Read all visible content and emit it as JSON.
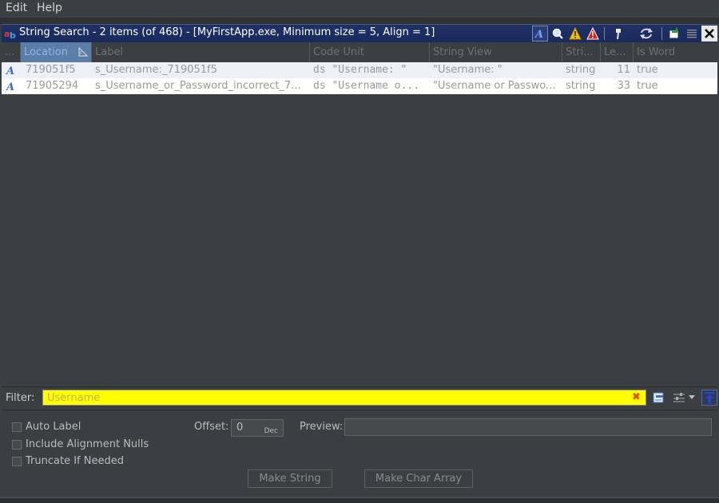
{
  "menu": {
    "edit": "Edit",
    "help": "Help"
  },
  "window": {
    "title": "String Search - 2 items (of 468) - [MyFirstApp.exe, Minimum size = 5, Align = 1]"
  },
  "table": {
    "columns": {
      "icon": "...",
      "location": "Location",
      "label": "Label",
      "code_unit": "Code Unit",
      "string_view": "String View",
      "string_type": "Stri...",
      "length": "Le...",
      "is_word": "Is Word"
    },
    "rows": [
      {
        "location": "719051f5",
        "label": "s_Username:_719051f5",
        "code_unit": "ds \"Username: \"",
        "string_view": "\"Username: \"",
        "string_type": "string",
        "length": "11",
        "is_word": "true"
      },
      {
        "location": "71905294",
        "label": "s_Username_or_Password_incorrect_7...",
        "code_unit": "ds \"Username o...",
        "string_view": "\"Username or Passwo...",
        "string_type": "string",
        "length": "33",
        "is_word": "true"
      }
    ]
  },
  "filter": {
    "label": "Filter:",
    "placeholder": "Username"
  },
  "options": {
    "auto_label": "Auto Label",
    "include_alignment_nulls": "Include Alignment Nulls",
    "truncate_if_needed": "Truncate If Needed",
    "offset_label": "Offset:",
    "offset_value": "0",
    "offset_unit": "Dec",
    "preview_label": "Preview:",
    "make_string": "Make String",
    "make_char_array": "Make Char Array"
  },
  "colors": {
    "accent": "#1f3168",
    "filter_bg": "#ffff00",
    "selected_header": "#5a7ea8"
  },
  "icons": [
    "string-search-icon",
    "defined-strings-filter-icon",
    "search-icon",
    "warning-icon",
    "error-icon",
    "pin-icon",
    "refresh-icon",
    "export-icon",
    "menu-icon",
    "close-icon",
    "string-icon",
    "clear-filter-icon",
    "filter-options-icon",
    "pin-filter-icon"
  ]
}
